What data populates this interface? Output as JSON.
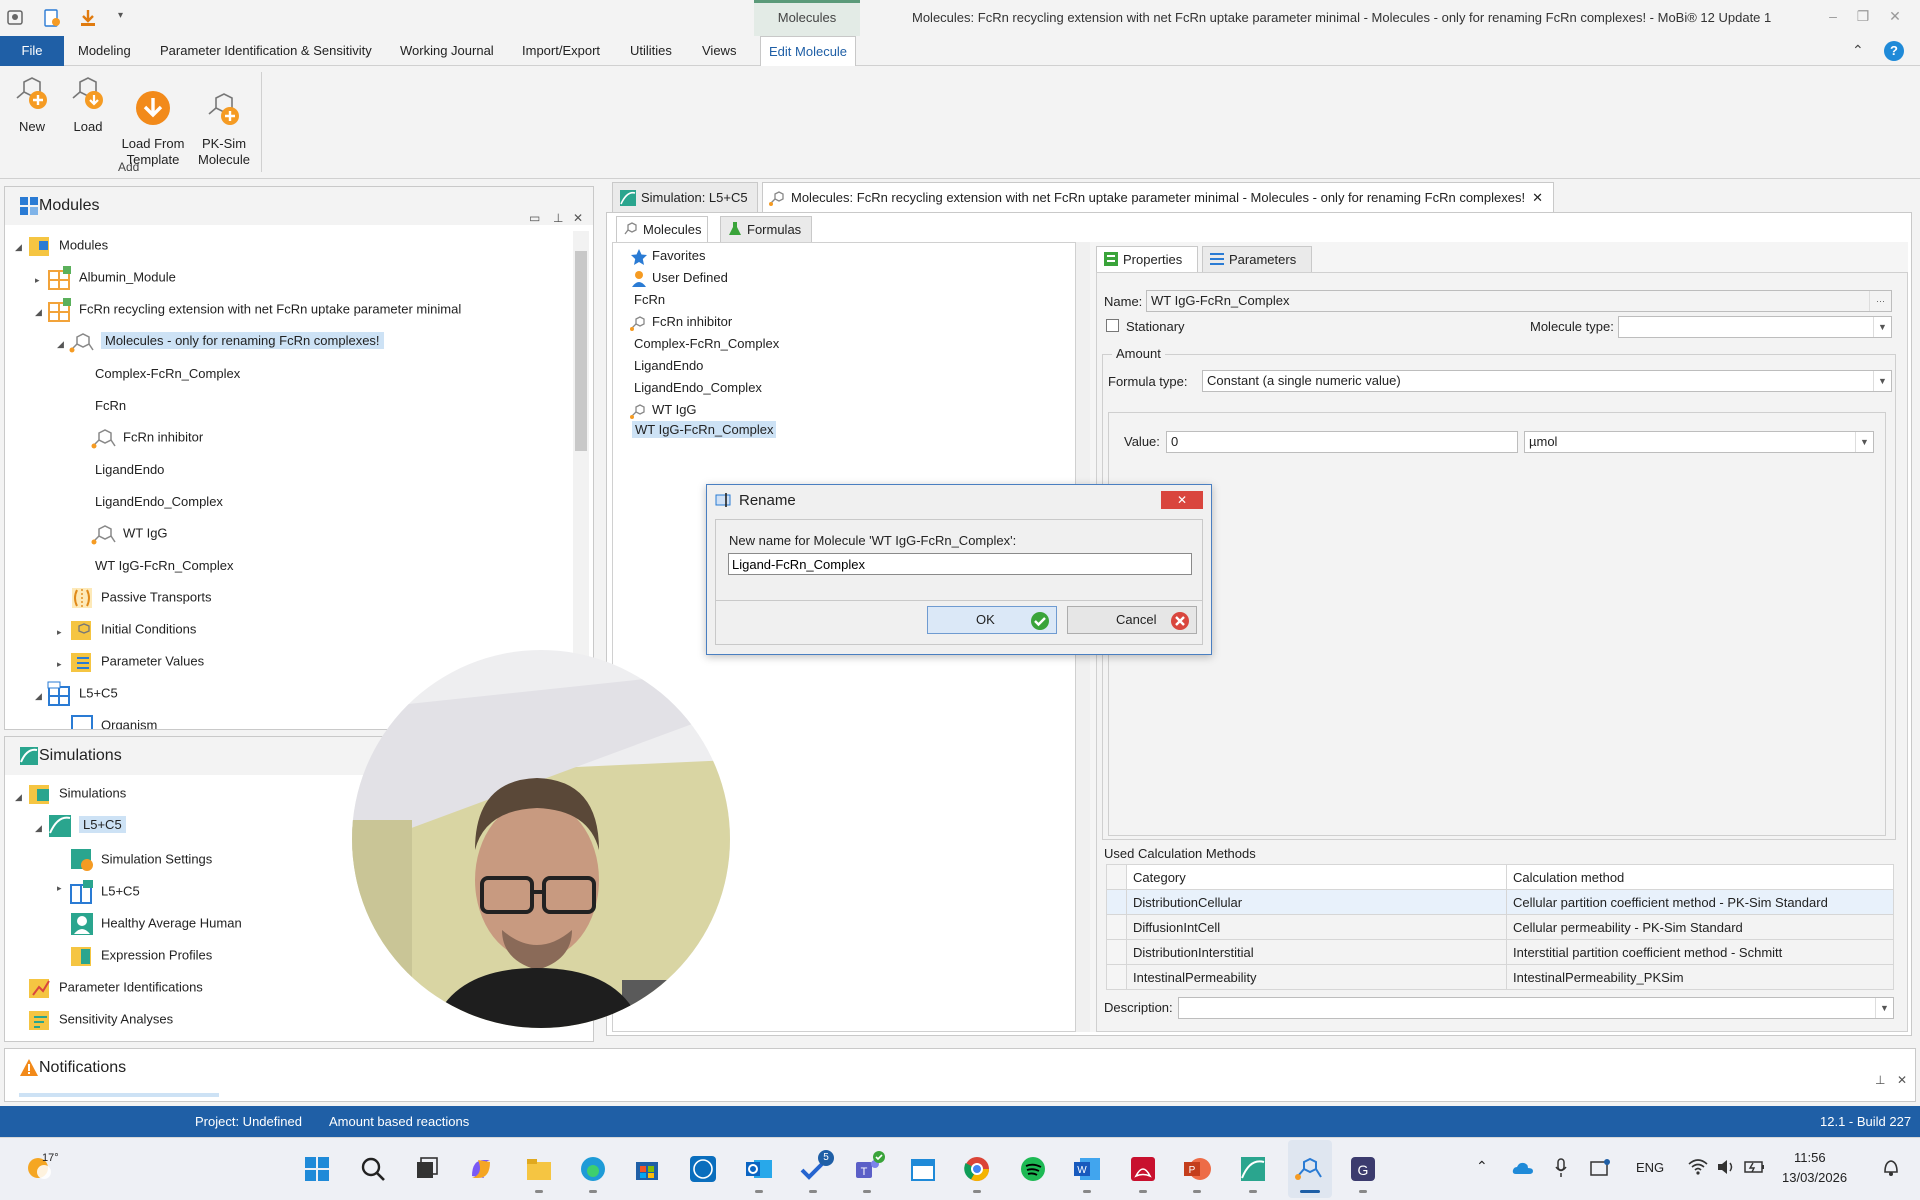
{
  "window": {
    "title": "Molecules: FcRn recycling extension with net FcRn uptake parameter minimal - Molecules - only for renaming FcRn complexes! - MoBi® 12 Update 1",
    "context_tab": "Molecules",
    "minimize": "–",
    "restore": "❐",
    "close": "✕"
  },
  "ribbon": {
    "tabs": [
      "File",
      "Modeling",
      "Parameter Identification & Sensitivity",
      "Working Journal",
      "Import/Export",
      "Utilities",
      "Views",
      "Edit Molecule"
    ],
    "active_tab": "Edit Molecule",
    "buttons": [
      {
        "label": "New"
      },
      {
        "label": "Load"
      },
      {
        "label": "Load From\nTemplate"
      },
      {
        "label": "PK-Sim\nMolecule"
      }
    ],
    "group_label": "Add",
    "collapse_glyph": "⌃",
    "help_glyph": "?"
  },
  "modules_panel": {
    "title": "Modules",
    "tree": [
      {
        "label": "Modules",
        "level": 0,
        "expanded": true
      },
      {
        "label": "Albumin_Module",
        "level": 1,
        "expanded": false
      },
      {
        "label": "FcRn recycling extension with net FcRn uptake parameter minimal",
        "level": 1,
        "expanded": true
      },
      {
        "label": "Molecules - only for renaming FcRn complexes!",
        "level": 2,
        "expanded": true,
        "selected": true
      },
      {
        "label": "Complex-FcRn_Complex",
        "level": 3
      },
      {
        "label": "FcRn",
        "level": 3
      },
      {
        "label": "FcRn inhibitor",
        "level": 3,
        "icon": "molecule-icon"
      },
      {
        "label": "LigandEndo",
        "level": 3
      },
      {
        "label": "LigandEndo_Complex",
        "level": 3
      },
      {
        "label": "WT IgG",
        "level": 3,
        "icon": "molecule-icon"
      },
      {
        "label": "WT IgG-FcRn_Complex",
        "level": 3
      },
      {
        "label": "Passive Transports",
        "level": 2
      },
      {
        "label": "Initial Conditions",
        "level": 2,
        "expanded": false
      },
      {
        "label": "Parameter Values",
        "level": 2,
        "expanded": false
      },
      {
        "label": "L5+C5",
        "level": 1,
        "expanded": true
      },
      {
        "label": "Organism",
        "level": 2
      }
    ]
  },
  "simulations_panel": {
    "title": "Simulations",
    "tree": [
      {
        "label": "Simulations",
        "level": 0
      },
      {
        "label": "L5+C5",
        "level": 1,
        "selected": true
      },
      {
        "label": "Simulation Settings",
        "level": 2
      },
      {
        "label": "L5+C5",
        "level": 2
      },
      {
        "label": "Healthy Average Human",
        "level": 2
      },
      {
        "label": "Expression Profiles",
        "level": 2
      },
      {
        "label": "Parameter Identifications",
        "level": 0
      },
      {
        "label": "Sensitivity Analyses",
        "level": 0
      }
    ]
  },
  "notifications_panel": {
    "title": "Notifications"
  },
  "document_tabs": [
    {
      "label": "Simulation: L5+C5",
      "active": false
    },
    {
      "label": "Molecules: FcRn recycling extension with net FcRn uptake parameter minimal - Molecules - only for renaming FcRn complexes!",
      "active": true
    }
  ],
  "molecule_subtabs": [
    "Molecules",
    "Formulas"
  ],
  "molecule_list": [
    {
      "label": "Favorites",
      "icon": "star-icon"
    },
    {
      "label": "User Defined",
      "icon": "user-icon"
    },
    {
      "label": "FcRn"
    },
    {
      "label": "FcRn inhibitor",
      "icon": "molecule-icon"
    },
    {
      "label": "Complex-FcRn_Complex"
    },
    {
      "label": "LigandEndo"
    },
    {
      "label": "LigandEndo_Complex"
    },
    {
      "label": "WT IgG",
      "icon": "molecule-icon"
    },
    {
      "label": "WT IgG-FcRn_Complex",
      "selected": true
    }
  ],
  "properties": {
    "tabs": [
      "Properties",
      "Parameters"
    ],
    "name_label": "Name:",
    "name_value": "WT IgG-FcRn_Complex",
    "stationary_label": "Stationary",
    "molecule_type_label": "Molecule type:",
    "molecule_type_value": "",
    "amount_label": "Amount",
    "formula_type_label": "Formula type:",
    "formula_type_value": "Constant (a single numeric value)",
    "value_label": "Value:",
    "value": "0",
    "unit": "µmol",
    "calc_methods_label": "Used Calculation Methods",
    "calc_headers": [
      "Category",
      "Calculation method"
    ],
    "calc_rows": [
      [
        "DistributionCellular",
        "Cellular partition coefficient method - PK-Sim Standard"
      ],
      [
        "DiffusionIntCell",
        "Cellular permeability - PK-Sim Standard"
      ],
      [
        "DistributionInterstitial",
        "Interstitial partition coefficient method - Schmitt"
      ],
      [
        "IntestinalPermeability",
        "IntestinalPermeability_PKSim"
      ]
    ],
    "description_label": "Description:",
    "description_value": ""
  },
  "rename_dialog": {
    "title": "Rename",
    "prompt": "New name for Molecule 'WT IgG-FcRn_Complex':",
    "input_value": "Ligand-FcRn_Complex",
    "ok_label": "OK",
    "cancel_label": "Cancel"
  },
  "statusbar": {
    "project": "Project: Undefined",
    "mode": "Amount based reactions",
    "version": "12.1 - Build 227"
  },
  "taskbar": {
    "weather_temp": "17°",
    "lang": "ENG",
    "time": "11:56",
    "date": "13/03/2026",
    "todo_badge": "5"
  },
  "colors": {
    "accent": "#1f5fa6",
    "context_green": "#5b9a79",
    "selection": "#cde2f5",
    "close_red": "#d9463e",
    "ok_green": "#3aa43a"
  }
}
